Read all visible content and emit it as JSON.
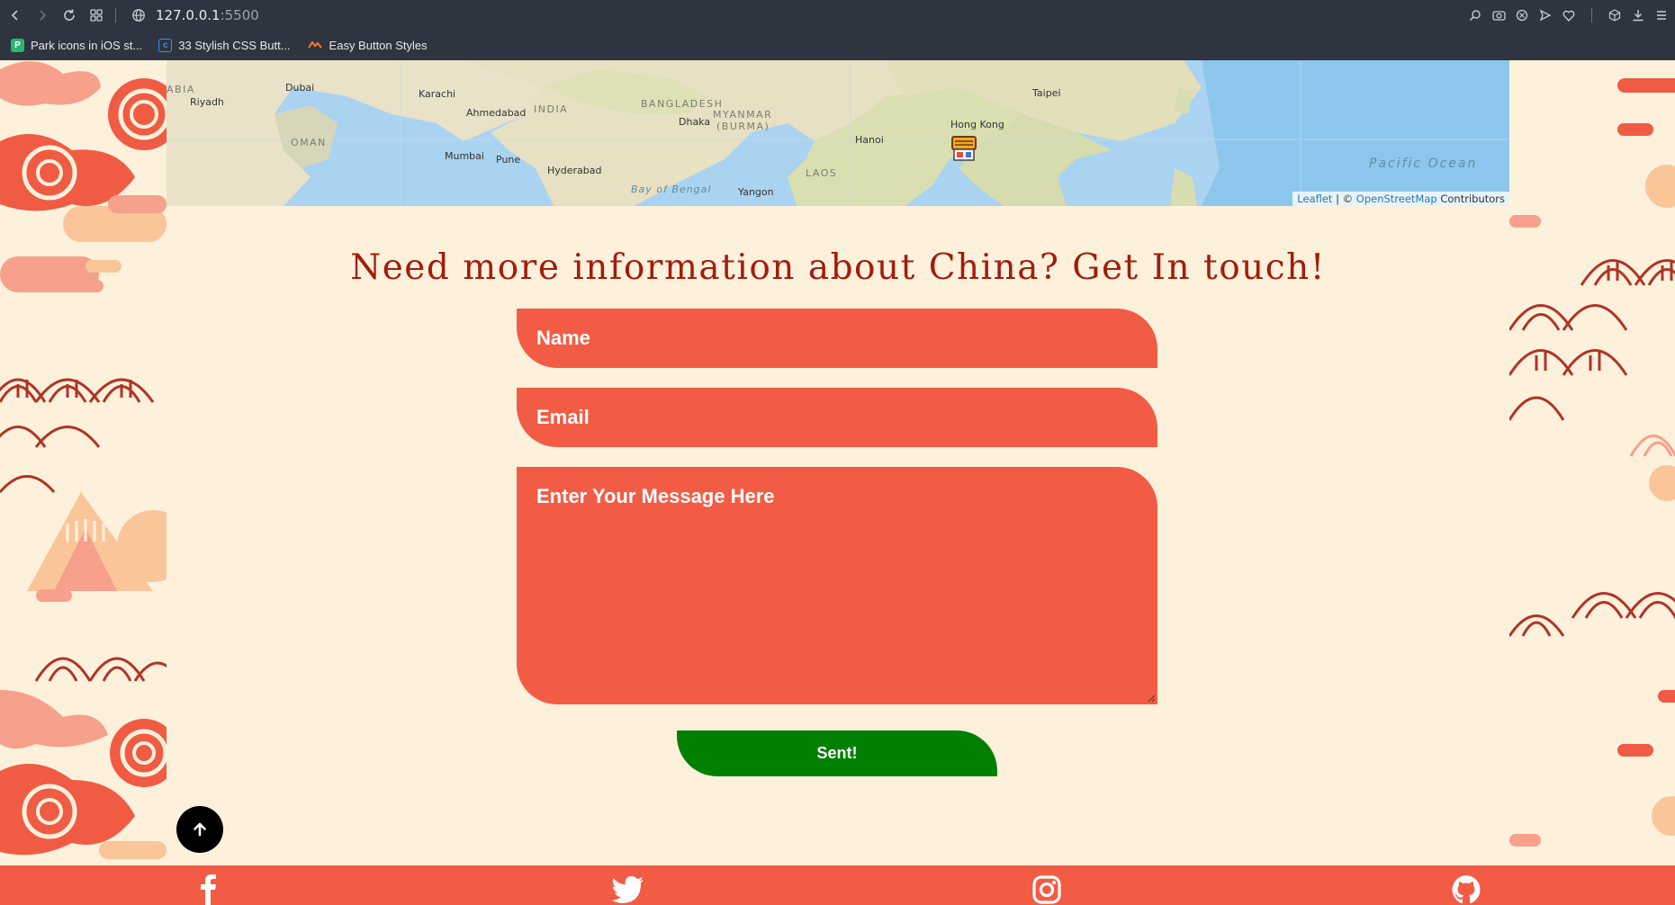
{
  "browser": {
    "url_host": "127.0.0.1",
    "url_port": ":5500",
    "bookmarks": [
      {
        "label": "Park icons in iOS st...",
        "icon": "park-icon"
      },
      {
        "label": "33 Stylish CSS Butt...",
        "icon": "css-icon"
      },
      {
        "label": "Easy Button Styles",
        "icon": "easy-icon"
      }
    ]
  },
  "map": {
    "labels": {
      "arabia": "ABIA",
      "riyadh": "Riyadh",
      "dubai": "Dubai",
      "karachi": "Karachi",
      "oman": "OMAN",
      "ahmedabad": "Ahmedabad",
      "india": "INDIA",
      "mumbai": "Mumbai",
      "pune": "Pune",
      "hyderabad": "Hyderabad",
      "bangladesh": "BANGLADESH",
      "dhaka": "Dhaka",
      "myanmar": "MYANMAR",
      "burma": "(BURMA)",
      "bay_of_bengal": "Bay of Bengal",
      "yangon": "Yangon",
      "laos": "LAOS",
      "hanoi": "Hanoi",
      "hong_kong": "Hong Kong",
      "taipei": "Taipei",
      "pacific_ocean": "Pacific Ocean"
    },
    "attribution": {
      "leaflet": "Leaflet",
      "separator": " | © ",
      "osm": "OpenStreetMap",
      "contributors": " Contributors"
    }
  },
  "contact": {
    "heading": "Need more information about China? Get In touch!",
    "name_placeholder": "Name",
    "email_placeholder": "Email",
    "message_placeholder": "Enter Your Message Here",
    "submit_label": "Sent!"
  },
  "footer": {
    "icons": [
      "facebook-icon",
      "twitter-icon",
      "instagram-icon",
      "github-icon"
    ]
  },
  "colors": {
    "accent": "#f25c44",
    "heading": "#a31c0d",
    "submit": "#008000",
    "background": "#fdf1dc"
  }
}
